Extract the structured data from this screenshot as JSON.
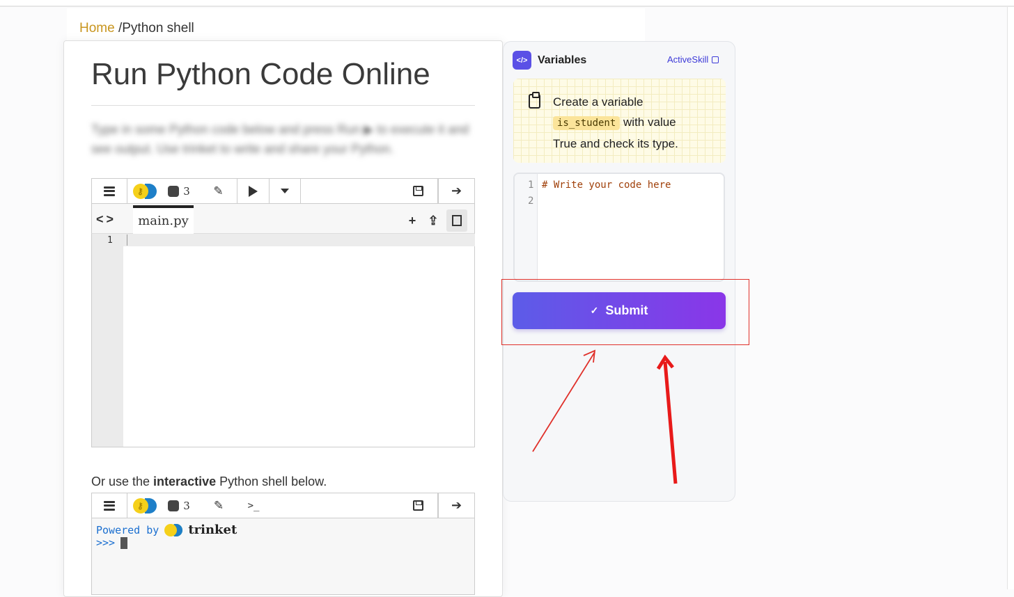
{
  "breadcrumb": {
    "home": "Home",
    "separator": " /",
    "current": "Python shell"
  },
  "page": {
    "title": "Run Python Code Online",
    "description": "Type in some Python code below and press Run ▶ to execute it and see output. Use trinket to write and share your Python.",
    "shell_intro": {
      "before": "Or use the ",
      "bold": "interactive",
      "after": " Python shell below."
    }
  },
  "trinket": {
    "python_version": "3",
    "tab_name": "main.py",
    "line_numbers": [
      "1"
    ],
    "shell_powered_by": "Powered by",
    "shell_brand": "trinket",
    "shell_prompt": ">>>",
    "terminal_glyph": ">_"
  },
  "side_panel": {
    "title": "Variables",
    "link": "ActiveSkill",
    "task": {
      "text1": "Create a variable",
      "code": "is_student",
      "text2": "with value",
      "text3": "True and check its type."
    },
    "editor": {
      "line_numbers": [
        "1",
        "2"
      ],
      "code": "# Write your code here"
    },
    "submit_label": "Submit"
  },
  "icons": [
    "menu-icon",
    "trinket-logo-icon",
    "python-icon",
    "pencil-icon",
    "play-icon",
    "caret-down-icon",
    "save-icon",
    "sign-in-icon",
    "code-nav-icon",
    "add-file-icon",
    "upload-icon",
    "image-icon",
    "terminal-icon",
    "code-icon",
    "external-link-icon",
    "clipboard-icon",
    "check-icon"
  ],
  "colors": {
    "accent": "#5b50e6",
    "submit_start": "#5c5ce8",
    "submit_end": "#8a36e8",
    "home_link": "#c8951e",
    "annotation": "#e0302a"
  }
}
